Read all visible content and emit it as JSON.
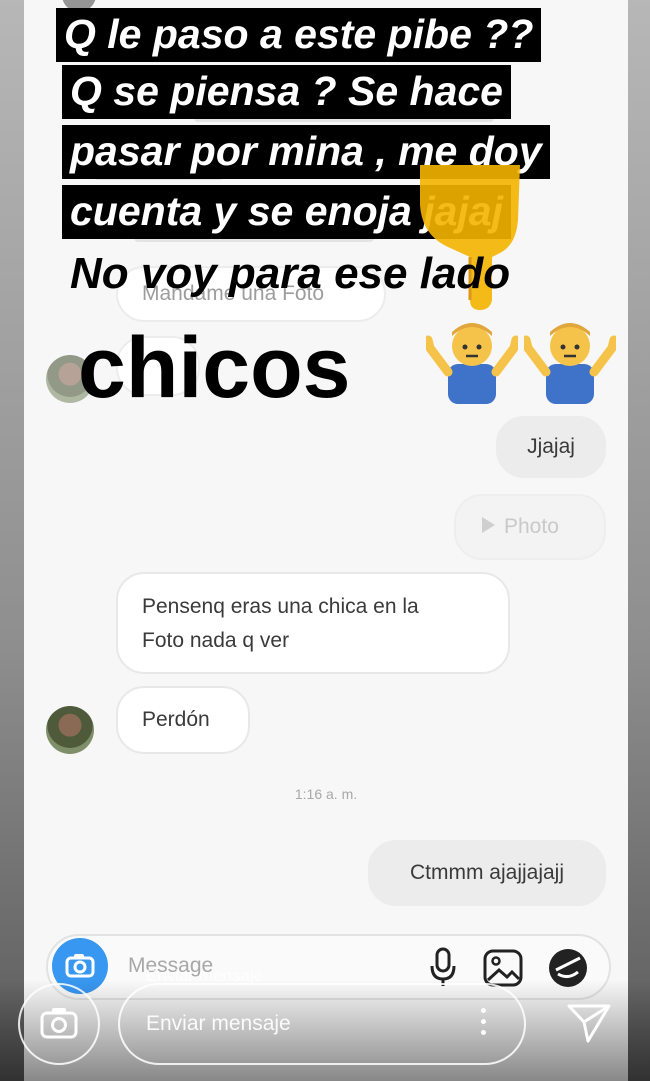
{
  "caption": {
    "lines": [
      "Q le paso a este pibe ??",
      "Q se piensa ? Se hace",
      "pasar por mina , me doy",
      "cuenta y se enoja jajaj"
    ],
    "plain_line": "No voy para ese lado",
    "big_word": "chicos",
    "emoji_names": [
      "man-shrugging-icon",
      "man-shrugging-icon",
      "backhand-index-pointing-down-icon"
    ]
  },
  "chat": {
    "faded_bubble_text": "Mandame una Foto",
    "messages": [
      {
        "text": "Jjajaj",
        "side": "right"
      },
      {
        "text": "Photo",
        "side": "right",
        "kind": "photo"
      },
      {
        "text": "Pensenq eras una chica en la Foto nada q ver",
        "line1": "Pensenq eras una chica en la",
        "line2": "Foto nada q ver",
        "side": "left"
      },
      {
        "text": "Perdón",
        "side": "left"
      },
      {
        "text": "Ctmmm ajajjajajj",
        "side": "right"
      }
    ],
    "timestamp": "1:16 a. m."
  },
  "composer": {
    "placeholder": "Message",
    "icons": [
      "camera-icon",
      "microphone-icon",
      "gallery-icon",
      "sticker-icon"
    ]
  },
  "story_reply": {
    "placeholder": "Enviar mensaje",
    "ghost_placeholder": "Enviar mensaje",
    "icons": [
      "camera-icon",
      "more-icon",
      "send-icon"
    ]
  },
  "colors": {
    "caption_bg": "#000000",
    "caption_text": "#ffffff",
    "accent_blue": "#3897f0",
    "bubble_border": "#e8e8e8"
  }
}
